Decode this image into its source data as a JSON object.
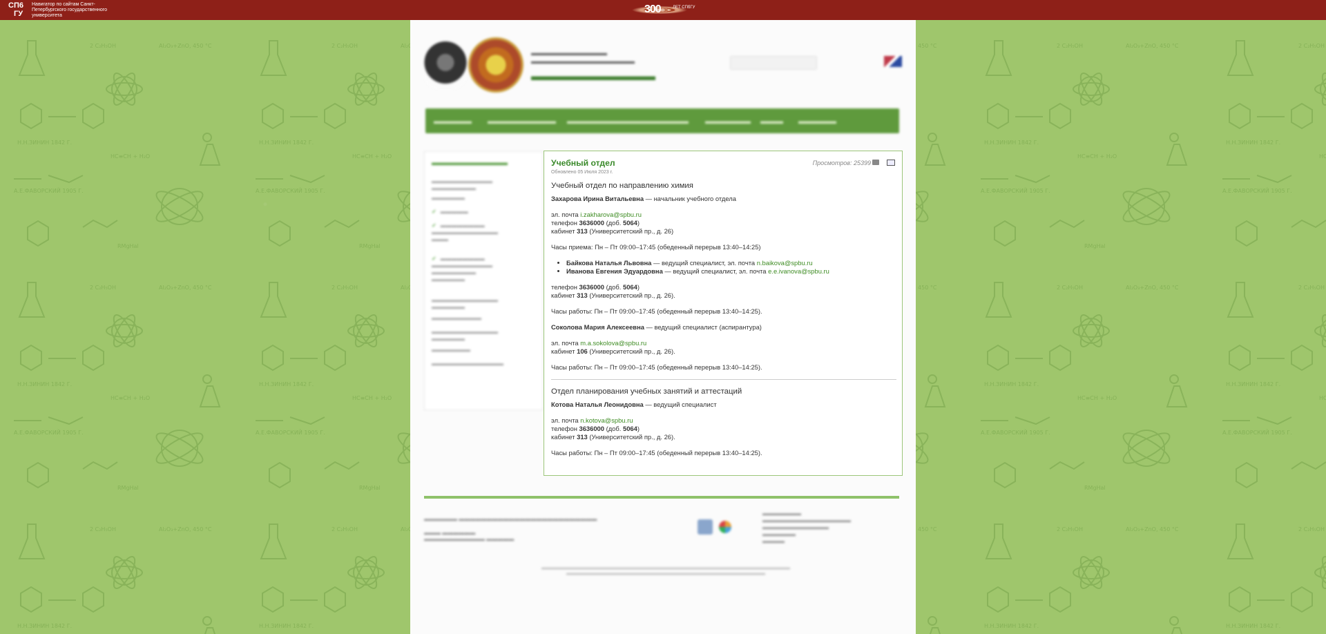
{
  "topbar": {
    "logo_line1": "СП6",
    "logo_line2": "ГУ",
    "navigator_text": "Навигатор по сайтам Санкт-Петербургского государственного университета",
    "jubilee_number": "300",
    "jubilee_caption": "ЛЕТ СПбГУ"
  },
  "content": {
    "title": "Учебный отдел",
    "updated": "Обновлено 05 Июля 2023 г.",
    "views": "Просмотров: 25399",
    "section1_title": "Учебный отдел по направлению химия",
    "head_name": "Захарова Ирина Витальевна",
    "head_role": " — начальник учебного отдела",
    "head_email_label": "эл. почта ",
    "head_email": "i.zakharova@spbu.ru",
    "phone_label": "телефон ",
    "phone": "3636000",
    "ext_prefix": " (доб. ",
    "ext": "5064",
    "ext_suffix": ")",
    "room_label": "кабинет ",
    "room313": "313",
    "address_paren": " (Университетский пр., д. 26)",
    "address_paren_dot": " (Университетский пр., д. 26).",
    "hours_reception": "Часы приема: Пн – Пт 09:00–17:45 (обеденный перерыв 13:40–14:25)",
    "hours_work": "Часы работы: Пн – Пт 09:00–17:45 (обеденный перерыв 13:40–14:25).",
    "spec1_name": "Байкова Наталья Львовна",
    "spec1_role": " — ведущий специалист, эл. почта ",
    "spec1_email": "n.baikova@spbu.ru",
    "spec2_name": "Иванова Евгения Эдуардовна",
    "spec2_role": " — ведущий специалист, эл. почта ",
    "spec2_email": "e.e.ivanova@spbu.ru",
    "spec3_name": "Соколова Мария Алексеевна",
    "spec3_role": " — ведущий специалист (аспирантура)",
    "spec3_email": "m.a.sokolova@spbu.ru",
    "room106": "106",
    "section2_title": "Отдел планирования учебных занятий и аттестаций",
    "spec4_name": "Котова Наталья Леонидовна",
    "spec4_role": " — ведущий специалист",
    "spec4_email": "n.kotova@spbu.ru"
  },
  "colors": {
    "topbar": "#8e2018",
    "wallpaper": "#9fc66c",
    "accent": "#3e8c23",
    "menubar": "#5f9a3d"
  }
}
